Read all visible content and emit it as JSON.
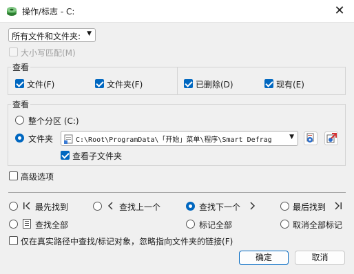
{
  "window": {
    "title": "操作/标志 - C:",
    "close_glyph": "✕",
    "app_icon": "disk-app-icon"
  },
  "filter": {
    "selected": "所有文件和文件夹:"
  },
  "match_case": {
    "label": "大小写匹配(M)",
    "checked": false,
    "disabled": true
  },
  "view_group1": {
    "title": "查看",
    "items": [
      {
        "label": "文件(F)",
        "checked": true
      },
      {
        "label": "文件夹(F)",
        "checked": true
      },
      {
        "label": "已删除(D)",
        "checked": true
      },
      {
        "label": "现有(E)",
        "checked": true
      }
    ]
  },
  "view_group2": {
    "title": "查看",
    "whole_partition": {
      "label": "整个分区 (C:)",
      "selected": false
    },
    "folder": {
      "label": "文件夹",
      "selected": true,
      "path": "C:\\Root\\ProgramData\\「开始」菜单\\程序\\Smart Defrag"
    },
    "subfolders": {
      "label": "查看子文件夹",
      "checked": true
    }
  },
  "advanced": {
    "label": "高级选项",
    "checked": false
  },
  "actions": {
    "find_first": "最先找到",
    "find_prev": "查找上一个",
    "find_next": "查找下一个",
    "find_last": "最后找到",
    "find_all": "查找全部",
    "mark_all": "标记全部",
    "unmark_all": "取消全部标记",
    "selected": "find_next"
  },
  "real_path": {
    "label": "仅在真实路径中查找/标记对象，忽略指向文件夹的链接(F)",
    "checked": false
  },
  "buttons": {
    "ok": "确定",
    "cancel": "取消"
  },
  "colors": {
    "accent": "#0067c0"
  }
}
